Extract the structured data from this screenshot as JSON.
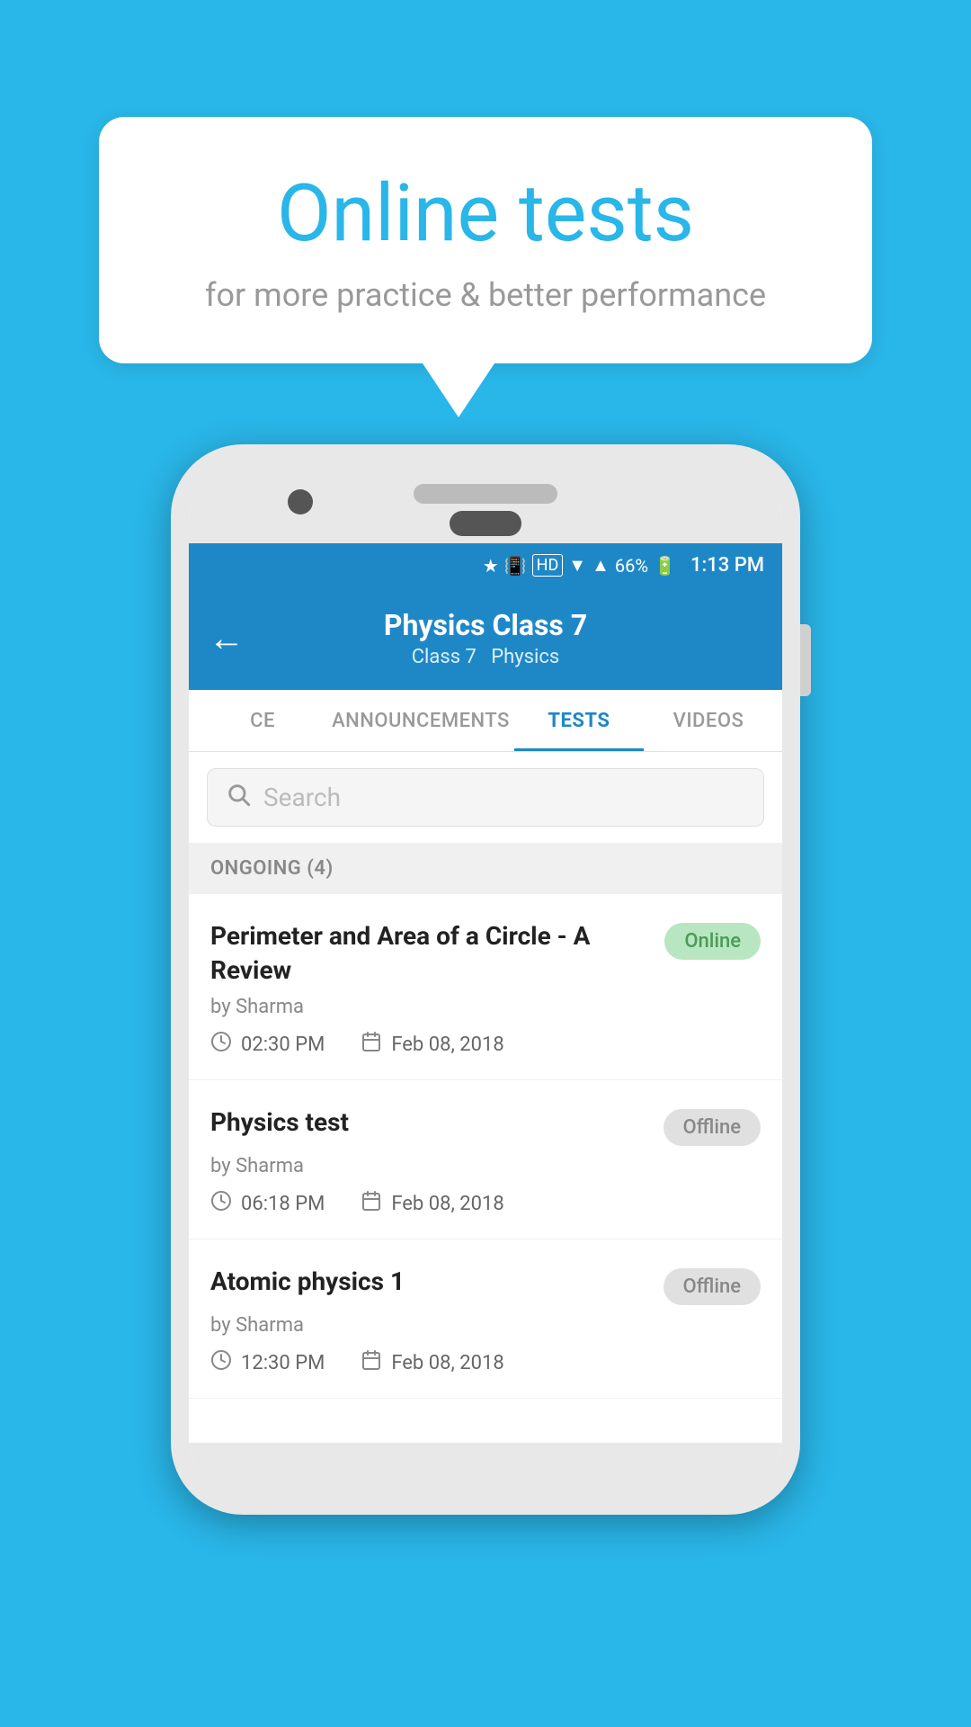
{
  "background_color": "#29b6e8",
  "callout": {
    "title": "Online tests",
    "subtitle": "for more practice & better performance"
  },
  "phone": {
    "status_bar": {
      "battery": "66%",
      "time": "1:13 PM"
    },
    "header": {
      "title": "Physics Class 7",
      "subtitle_parts": [
        "Class 7",
        "Physics"
      ],
      "back_icon": "←"
    },
    "tabs": [
      {
        "label": "CE",
        "active": false
      },
      {
        "label": "ANNOUNCEMENTS",
        "active": false
      },
      {
        "label": "TESTS",
        "active": true
      },
      {
        "label": "VIDEOS",
        "active": false
      }
    ],
    "search": {
      "placeholder": "Search"
    },
    "section": {
      "label": "ONGOING (4)"
    },
    "tests": [
      {
        "title": "Perimeter and Area of a Circle - A Review",
        "status": "Online",
        "status_type": "online",
        "author": "by Sharma",
        "time": "02:30 PM",
        "date": "Feb 08, 2018"
      },
      {
        "title": "Physics test",
        "status": "Offline",
        "status_type": "offline",
        "author": "by Sharma",
        "time": "06:18 PM",
        "date": "Feb 08, 2018"
      },
      {
        "title": "Atomic physics 1",
        "status": "Offline",
        "status_type": "offline",
        "author": "by Sharma",
        "time": "12:30 PM",
        "date": "Feb 08, 2018"
      }
    ]
  }
}
